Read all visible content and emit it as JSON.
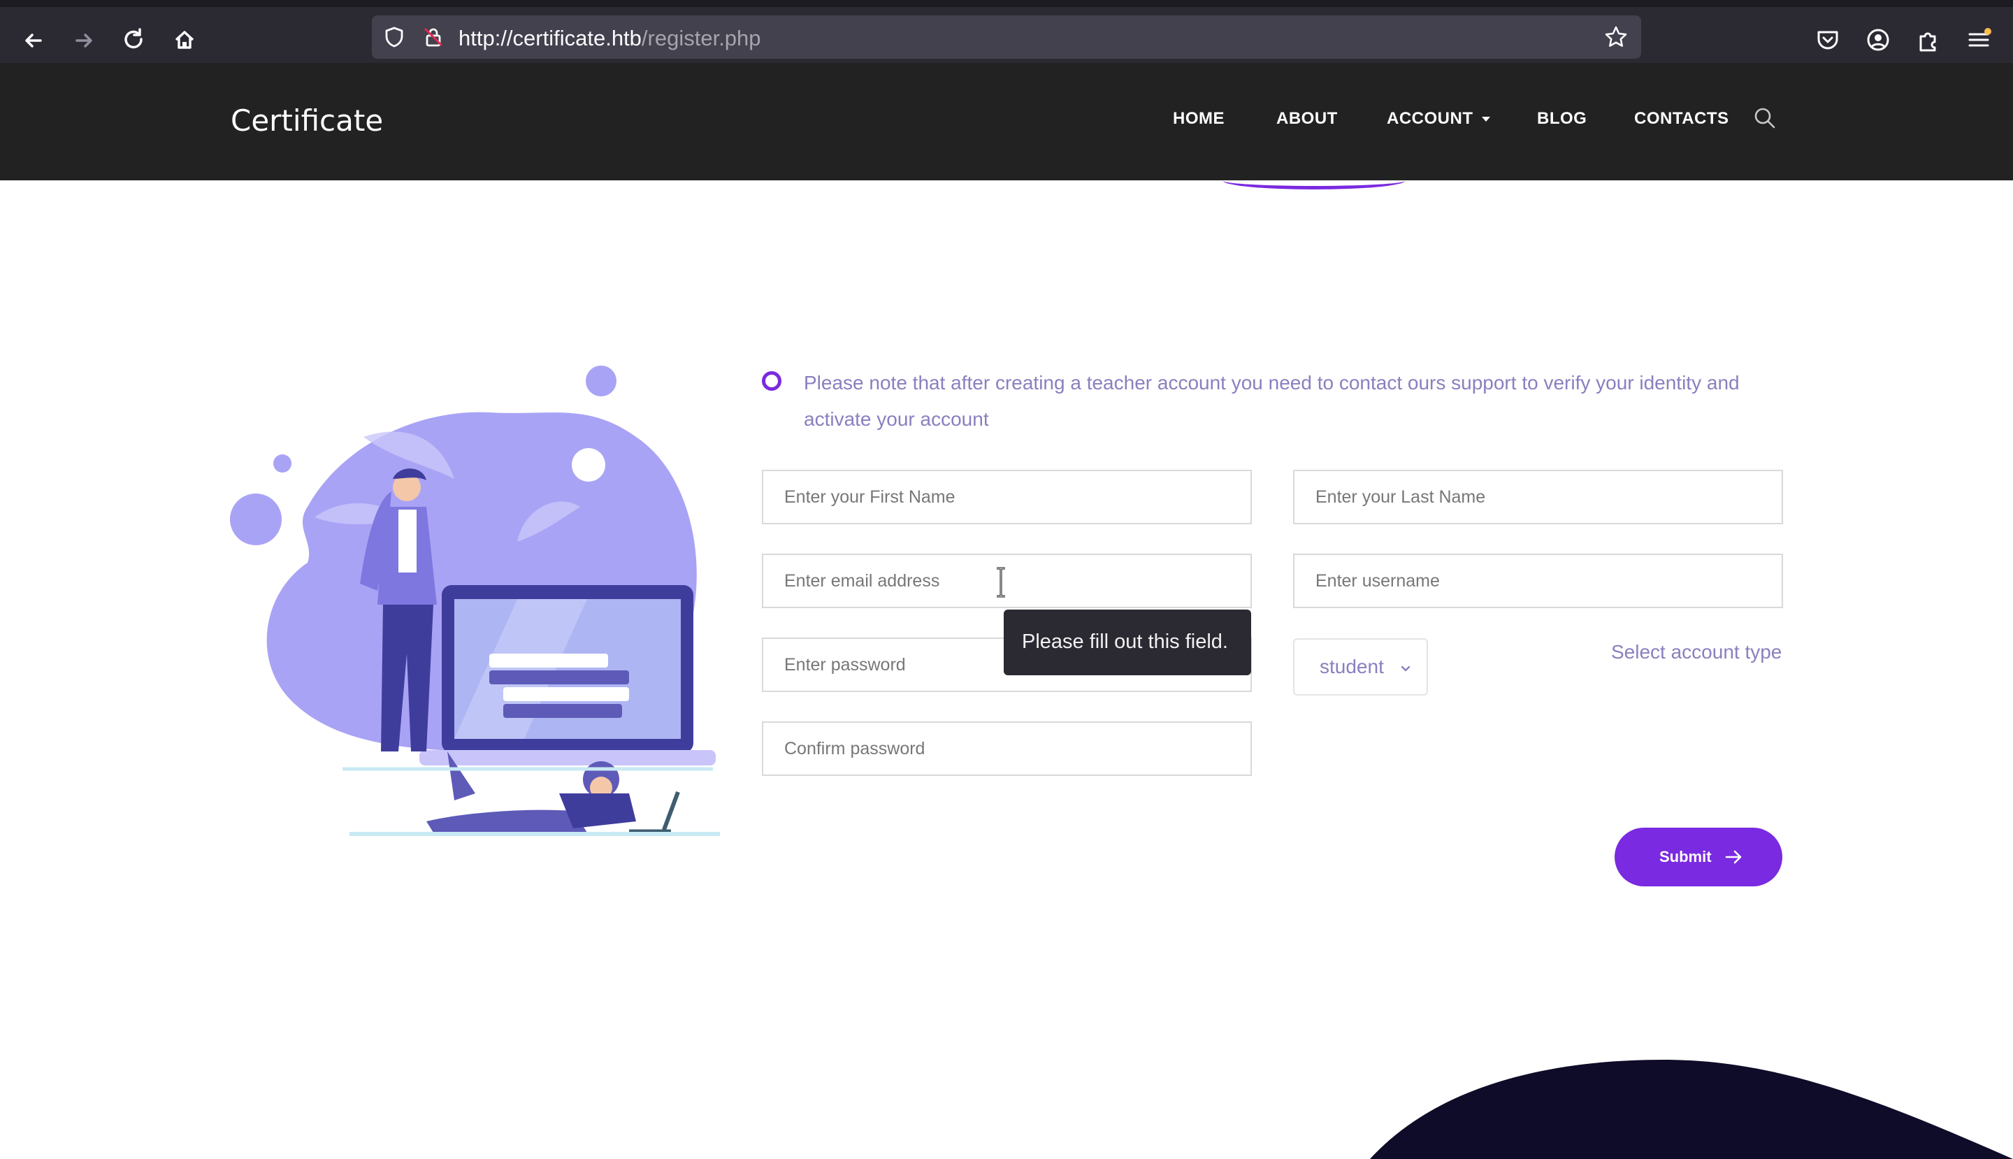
{
  "browser": {
    "url_host": "http://certificate.htb",
    "url_path": "/register.php"
  },
  "site": {
    "brand": "Certificate",
    "menu": [
      {
        "label": "HOME"
      },
      {
        "label": "ABOUT"
      },
      {
        "label": "ACCOUNT",
        "has_dropdown": true
      },
      {
        "label": "BLOG"
      },
      {
        "label": "CONTACTS"
      }
    ]
  },
  "notice": {
    "text": "Please note that after creating a teacher account you need to contact ours support to verify your identity and activate your account"
  },
  "form": {
    "first_name_placeholder": "Enter your First Name",
    "last_name_placeholder": "Enter your Last Name",
    "email_placeholder": "Enter email address",
    "username_placeholder": "Enter username",
    "password_placeholder": "Enter password",
    "confirm_password_placeholder": "Confirm password",
    "account_type_value": "student",
    "account_type_label": "Select account type",
    "submit_label": "Submit",
    "validation_tooltip": "Please fill out this field."
  },
  "colors": {
    "accent": "#7a2ae0",
    "header_bg": "#222222",
    "muted_text": "#8b7fbf",
    "illustration": "#a9a3f5"
  }
}
